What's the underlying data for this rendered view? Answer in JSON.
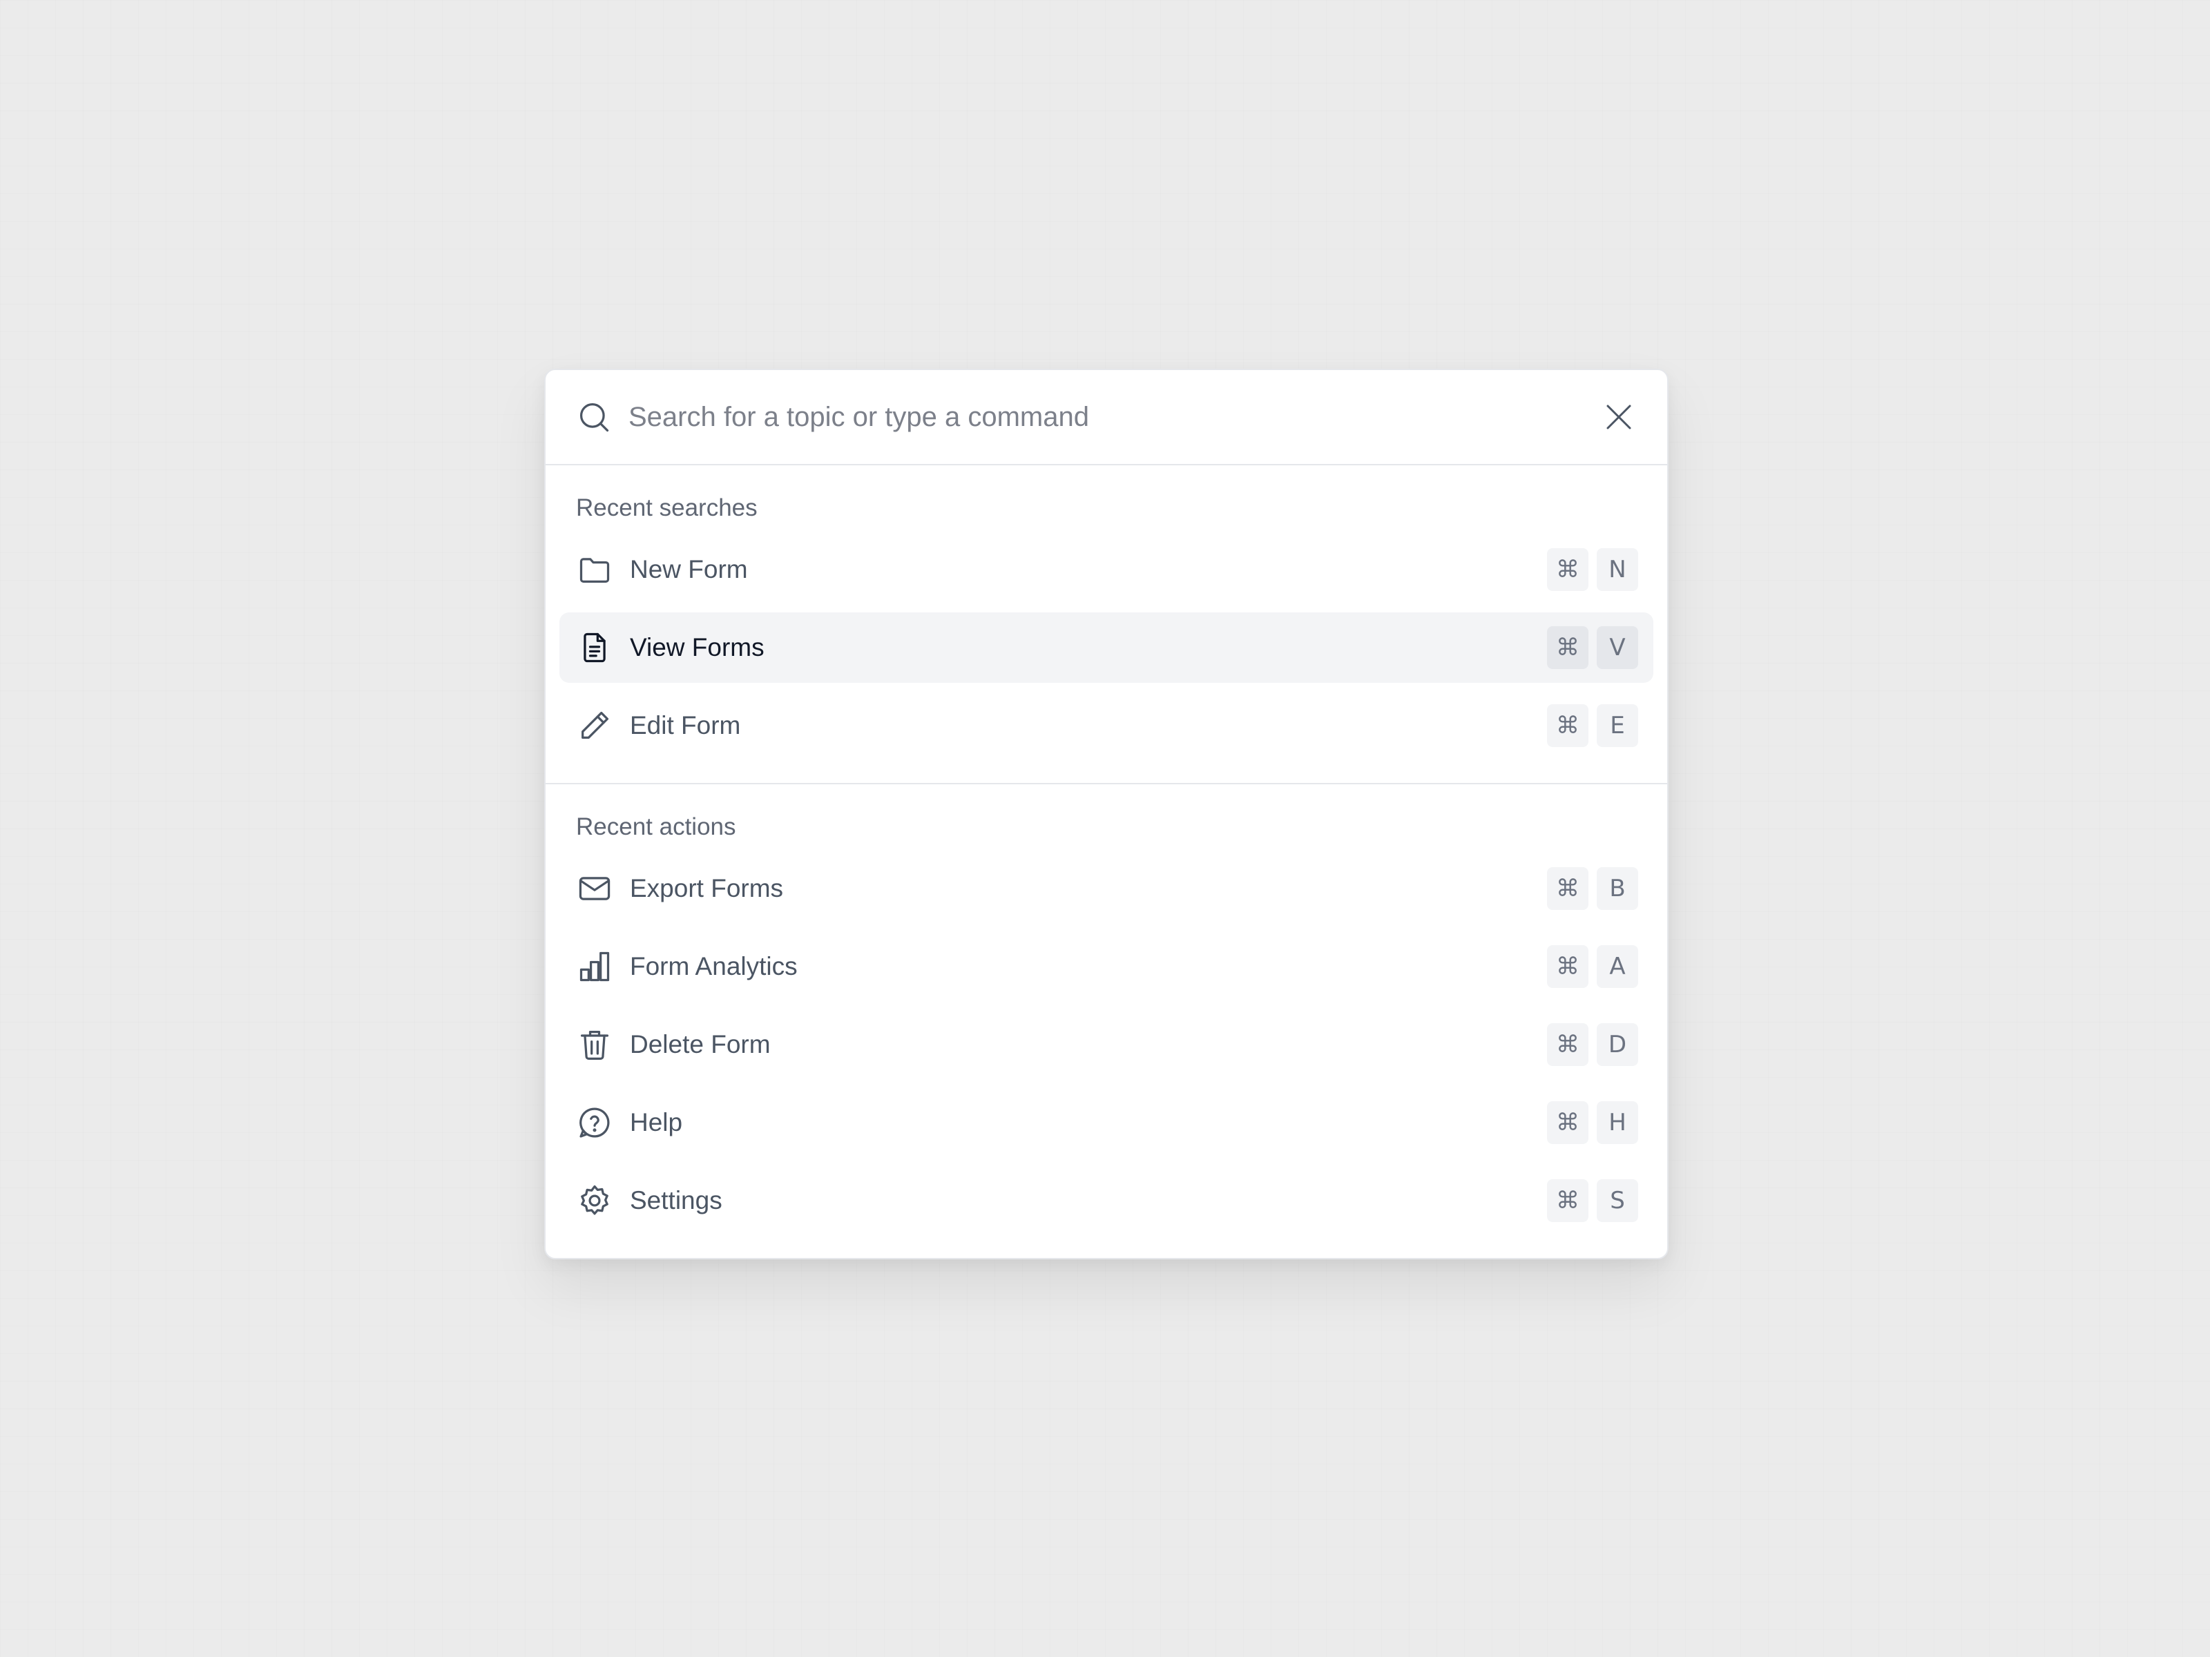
{
  "search": {
    "placeholder": "Search for a topic or type a command",
    "value": ""
  },
  "sections": [
    {
      "title": "Recent searches",
      "items": [
        {
          "label": "New Form",
          "icon": "folder-icon",
          "modifier": "⌘",
          "key": "N",
          "active": false
        },
        {
          "label": "View Forms",
          "icon": "document-icon",
          "modifier": "⌘",
          "key": "V",
          "active": true
        },
        {
          "label": "Edit Form",
          "icon": "pencil-icon",
          "modifier": "⌘",
          "key": "E",
          "active": false
        }
      ]
    },
    {
      "title": "Recent actions",
      "items": [
        {
          "label": "Export Forms",
          "icon": "envelope-icon",
          "modifier": "⌘",
          "key": "B",
          "active": false
        },
        {
          "label": "Form Analytics",
          "icon": "bar-chart-icon",
          "modifier": "⌘",
          "key": "A",
          "active": false
        },
        {
          "label": "Delete Form",
          "icon": "trash-icon",
          "modifier": "⌘",
          "key": "D",
          "active": false
        },
        {
          "label": "Help",
          "icon": "help-circle-icon",
          "modifier": "⌘",
          "key": "H",
          "active": false
        },
        {
          "label": "Settings",
          "icon": "gear-icon",
          "modifier": "⌘",
          "key": "S",
          "active": false
        }
      ]
    }
  ],
  "colors": {
    "background": "#ebebeb",
    "panel": "#ffffff",
    "active_row": "#f3f4f6",
    "icon": "#4b5563"
  }
}
